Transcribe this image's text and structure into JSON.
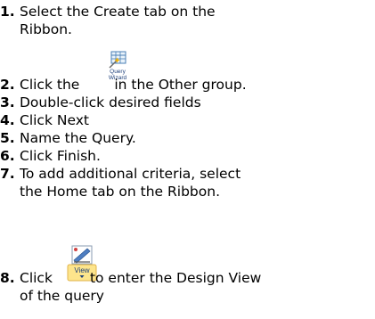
{
  "steps": [
    {
      "number": "1.",
      "lines": [
        "Select the Create tab on the",
        "Ribbon."
      ]
    },
    {
      "number": "2.",
      "before": "Click the",
      "after": "in the Other group.",
      "icon": "query-wizard-icon",
      "icon_label_1": "Query",
      "icon_label_2": "Wizard"
    },
    {
      "number": "3.",
      "lines": [
        "Double-click desired fields"
      ]
    },
    {
      "number": "4.",
      "lines": [
        "Click Next"
      ]
    },
    {
      "number": "5.",
      "lines": [
        "Name the Query."
      ]
    },
    {
      "number": "6.",
      "lines": [
        "Click Finish."
      ]
    },
    {
      "number": "7.",
      "lines": [
        "To add additional criteria, select",
        "the Home tab on the Ribbon."
      ]
    },
    {
      "number": "8.",
      "before": "Click",
      "after": "to enter the Design View",
      "line2": "of the query",
      "icon": "view-button-icon",
      "icon_label": "View"
    }
  ]
}
